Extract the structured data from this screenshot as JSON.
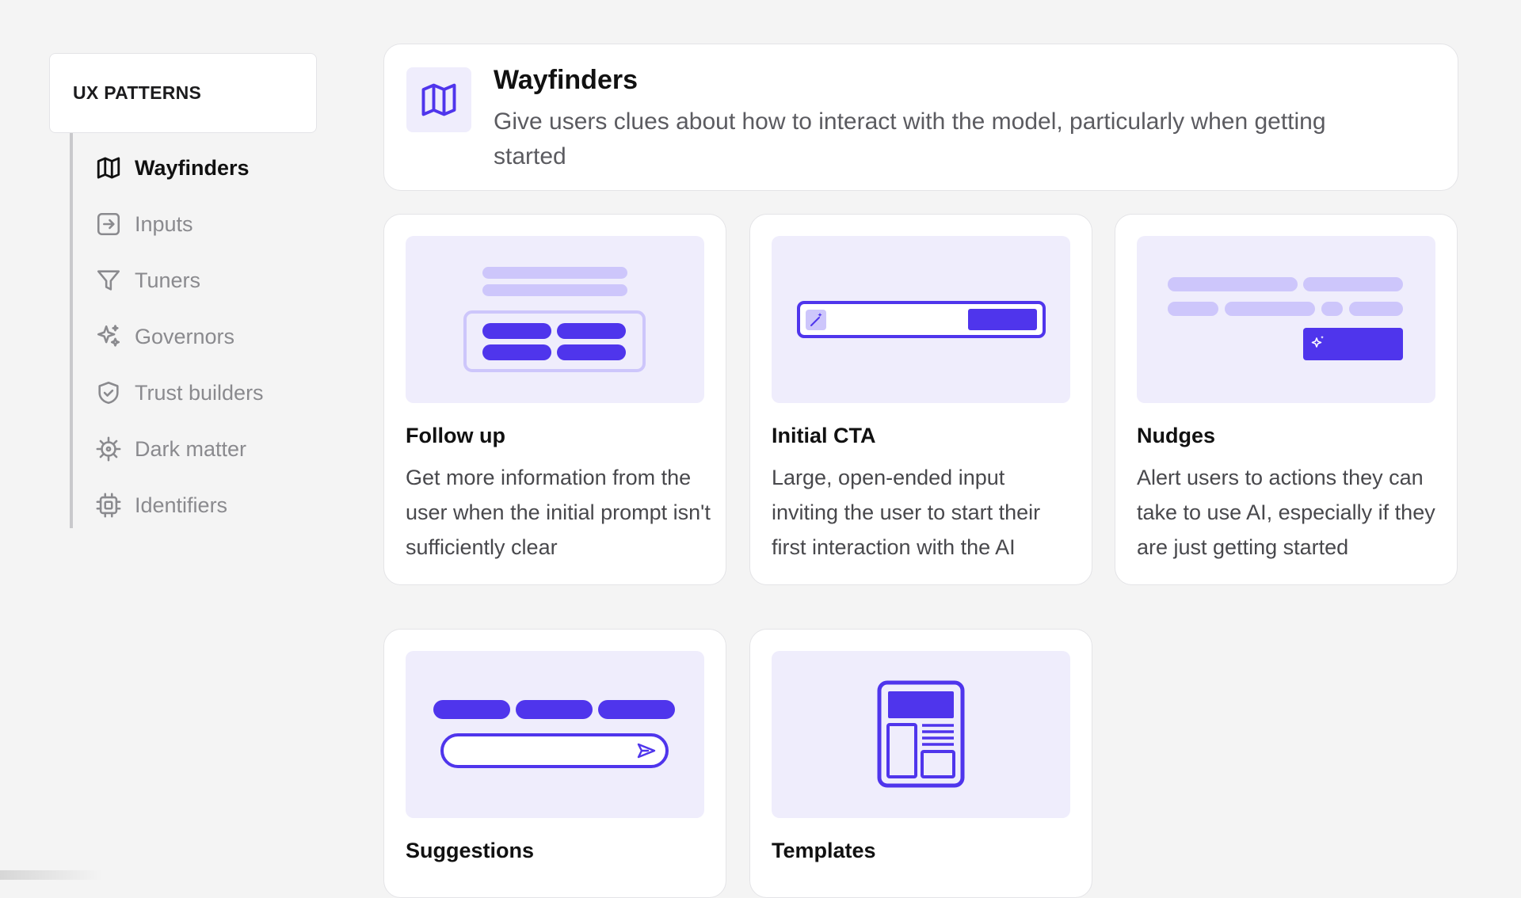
{
  "sidebar": {
    "header": "UX PATTERNS",
    "items": [
      {
        "label": "Wayfinders",
        "icon": "map-icon",
        "active": true
      },
      {
        "label": "Inputs",
        "icon": "arrow-in-square-icon",
        "active": false
      },
      {
        "label": "Tuners",
        "icon": "filter-icon",
        "active": false
      },
      {
        "label": "Governors",
        "icon": "sparkle-icon",
        "active": false
      },
      {
        "label": "Trust builders",
        "icon": "shield-check-icon",
        "active": false
      },
      {
        "label": "Dark matter",
        "icon": "virus-icon",
        "active": false
      },
      {
        "label": "Identifiers",
        "icon": "chip-icon",
        "active": false
      }
    ]
  },
  "header": {
    "icon": "map-icon",
    "title": "Wayfinders",
    "description": "Give users clues about how to interact with the model, particularly when getting started"
  },
  "cards": [
    {
      "title": "Follow up",
      "description": "Get more information from the user when the initial prompt isn't sufficiently clear"
    },
    {
      "title": "Initial CTA",
      "description": "Large, open-ended input inviting the user to start their first interaction with the AI"
    },
    {
      "title": "Nudges",
      "description": "Alert users to actions they can take to use AI, especially if they are just getting started"
    },
    {
      "title": "Suggestions",
      "description": ""
    },
    {
      "title": "Templates",
      "description": ""
    }
  ],
  "colors": {
    "accent": "#4f35ec",
    "accent_light": "#cdc6fb",
    "thumb_bg": "#efedfc",
    "muted_text": "#8a8a8e"
  }
}
